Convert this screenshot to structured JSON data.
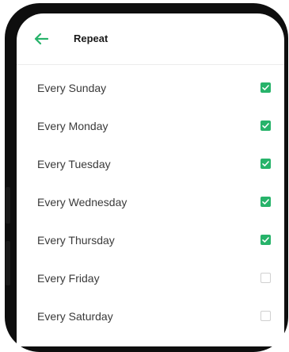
{
  "header": {
    "title": "Repeat",
    "back_icon": "arrow-left-icon",
    "accent": "#27b36a"
  },
  "days": [
    {
      "label": "Every Sunday",
      "checked": true
    },
    {
      "label": "Every Monday",
      "checked": true
    },
    {
      "label": "Every Tuesday",
      "checked": true
    },
    {
      "label": "Every Wednesday",
      "checked": true
    },
    {
      "label": "Every Thursday",
      "checked": true
    },
    {
      "label": "Every Friday",
      "checked": false
    },
    {
      "label": "Every Saturday",
      "checked": false
    }
  ],
  "checkbox_color": "#27b36a"
}
